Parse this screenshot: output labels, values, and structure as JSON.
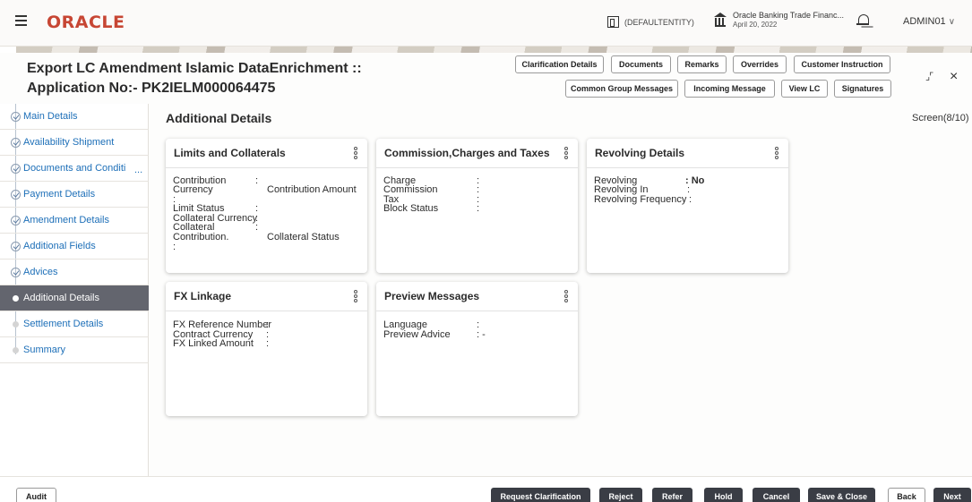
{
  "header": {
    "logo": "ORACLE",
    "entity": "(DEFAULTENTITY)",
    "bank_name": "Oracle Banking Trade Financ...",
    "bank_date": "April 20, 2022",
    "user": "ADMIN01",
    "user_chevron": "∨"
  },
  "page": {
    "title_line1": "Export LC Amendment Islamic DataEnrichment ::",
    "title_line2": "Application No:- PK2IELM000064475",
    "buttons_row1": [
      "Clarification Details",
      "Documents",
      "Remarks",
      "Overrides",
      "Customer Instruction"
    ],
    "buttons_row2": [
      "Common Group Messages",
      "Incoming Message",
      "View LC",
      "Signatures"
    ],
    "minimize_icon": "∕",
    "close_icon": "×"
  },
  "sidebar": {
    "items": [
      {
        "label": "Main Details",
        "state": "done"
      },
      {
        "label": "Availability Shipment",
        "state": "done"
      },
      {
        "label": "Documents and Conditi",
        "state": "done"
      },
      {
        "label": "Payment Details",
        "state": "done"
      },
      {
        "label": "Amendment Details",
        "state": "done"
      },
      {
        "label": "Additional Fields",
        "state": "done"
      },
      {
        "label": "Advices",
        "state": "done"
      },
      {
        "label": "Additional Details",
        "state": "active"
      },
      {
        "label": "Settlement Details",
        "state": "pending"
      },
      {
        "label": "Summary",
        "state": "pending"
      }
    ],
    "ellipsis": "..."
  },
  "content": {
    "title": "Additional Details",
    "screen": "Screen(8/10)",
    "cards": {
      "limits": {
        "title": "Limits and Collaterals",
        "contribution": "Contribution",
        "currency": "Currency",
        "contribution_amount": "Contribution Amount",
        "limit_status": "Limit Status",
        "collateral_currency": "Collateral Currency",
        "collateral": "Collateral",
        "contribution_dot": "Contribution.",
        "collateral_status": "Collateral Status",
        "colon": ":"
      },
      "commission": {
        "title": "Commission,Charges and Taxes",
        "charge": "Charge",
        "commission": "Commission",
        "tax": "Tax",
        "block_status": "Block Status",
        "colon": ":"
      },
      "revolving": {
        "title": "Revolving Details",
        "revolving": "Revolving",
        "revolving_value": ": No",
        "revolving_in": "Revolving In",
        "revolving_frequency": "Revolving Frequency",
        "colon": ":"
      },
      "fx": {
        "title": "FX Linkage",
        "fx_reference_number": "FX Reference Number",
        "contract_currency": "Contract Currency",
        "fx_linked_amount": "FX Linked Amount",
        "colon": ":"
      },
      "preview": {
        "title": "Preview Messages",
        "language": "Language",
        "preview_advice": "Preview Advice",
        "preview_advice_value": ": -",
        "colon": ":"
      }
    }
  },
  "footer": {
    "audit": "Audit",
    "buttons": [
      "Request Clarification",
      "Reject",
      "Refer",
      "Hold",
      "Cancel",
      "Save & Close"
    ],
    "back": "Back",
    "next": "Next"
  }
}
